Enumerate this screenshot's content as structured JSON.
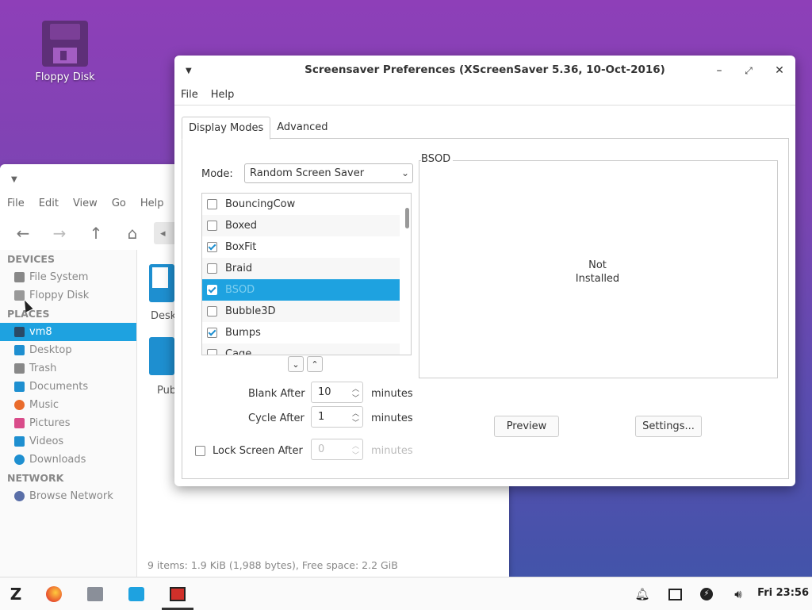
{
  "desktop": {
    "icon_label": "Floppy Disk"
  },
  "file_manager": {
    "menu": [
      "File",
      "Edit",
      "View",
      "Go",
      "Help"
    ],
    "sections": {
      "devices": "DEVICES",
      "places": "PLACES",
      "network": "NETWORK"
    },
    "devices": [
      "File System",
      "Floppy Disk"
    ],
    "places": [
      "vm8",
      "Desktop",
      "Trash",
      "Documents",
      "Music",
      "Pictures",
      "Videos",
      "Downloads"
    ],
    "network": [
      "Browse Network"
    ],
    "files": [
      "Desk",
      "Pub"
    ],
    "status": "9 items: 1.9 KiB (1,988 bytes), Free space: 2.2 GiB"
  },
  "dialog": {
    "title": "Screensaver Preferences  (XScreenSaver 5.36, 10-Oct-2016)",
    "menu": [
      "File",
      "Help"
    ],
    "tabs": [
      "Display Modes",
      "Advanced"
    ],
    "mode_label": "Mode:",
    "mode_value": "Random Screen Saver",
    "list": [
      {
        "name": "BouncingCow",
        "checked": false
      },
      {
        "name": "Boxed",
        "checked": false
      },
      {
        "name": "BoxFit",
        "checked": true
      },
      {
        "name": "Braid",
        "checked": false
      },
      {
        "name": "BSOD",
        "checked": true,
        "selected": true
      },
      {
        "name": "Bubble3D",
        "checked": false
      },
      {
        "name": "Bumps",
        "checked": true
      },
      {
        "name": "Cage",
        "checked": false
      }
    ],
    "blank_after_label": "Blank After",
    "blank_after_value": "10",
    "cycle_after_label": "Cycle After",
    "cycle_after_value": "1",
    "lock_label": "Lock Screen After",
    "lock_value": "0",
    "minutes": "minutes",
    "preview_group": "BSOD",
    "not_installed_1": "Not",
    "not_installed_2": "Installed",
    "preview_button": "Preview",
    "settings_button": "Settings..."
  },
  "taskbar": {
    "clock": "Fri 23:56"
  },
  "colors": {
    "accent": "#1ea2e0",
    "desktop_top": "#8e3fb8",
    "desktop_bottom": "#3e55a8"
  }
}
